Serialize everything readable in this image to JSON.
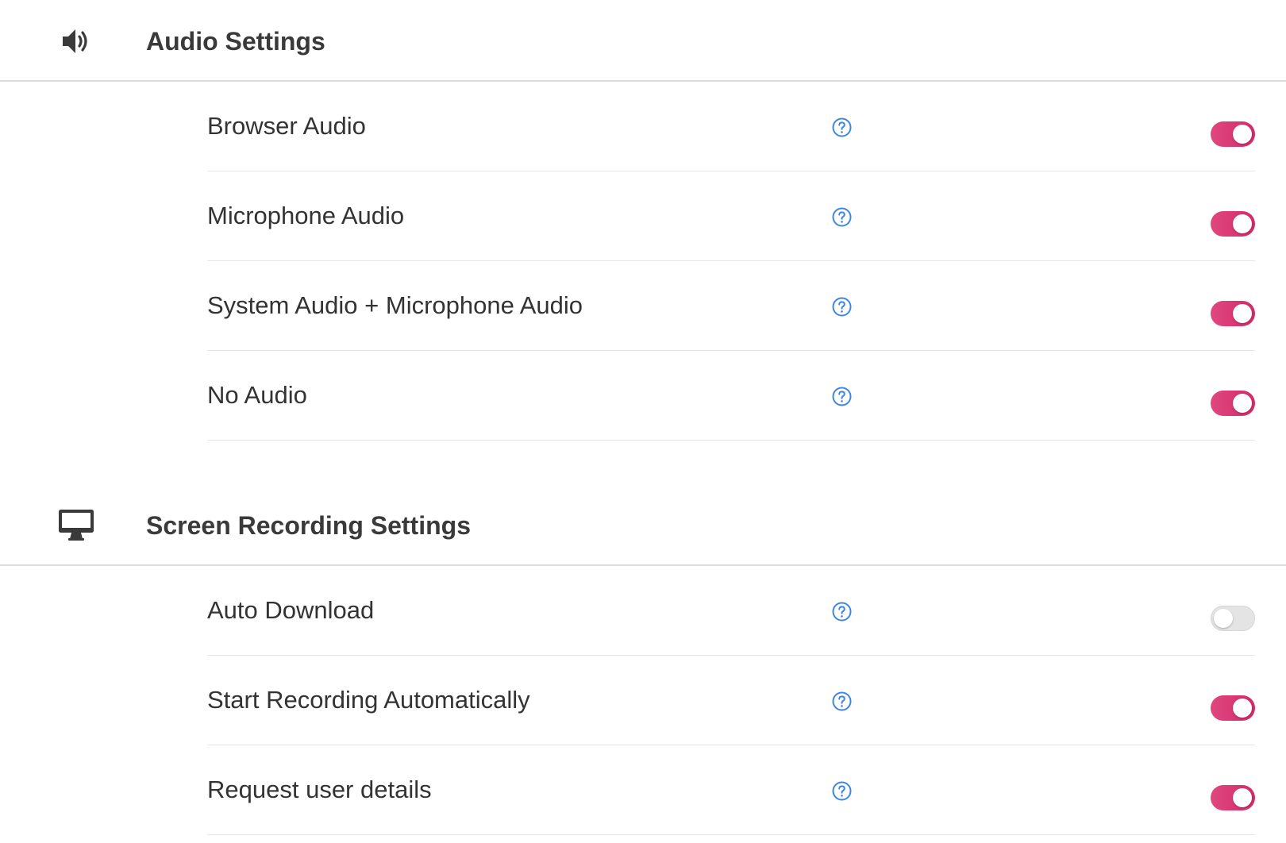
{
  "colors": {
    "accent": "#d92e71",
    "help_icon": "#3f86e0",
    "toggle_off": "#e4e4e4",
    "divider": "#dcdcdc"
  },
  "audio_section": {
    "icon": "speaker-icon",
    "title": "Audio Settings",
    "rows": [
      {
        "label": "Browser Audio",
        "enabled": true
      },
      {
        "label": "Microphone Audio",
        "enabled": true
      },
      {
        "label": "System Audio + Microphone Audio",
        "enabled": true
      },
      {
        "label": "No Audio",
        "enabled": true
      }
    ]
  },
  "screen_section": {
    "icon": "desktop-monitor-icon",
    "title": "Screen Recording Settings",
    "rows": [
      {
        "label": "Auto Download",
        "enabled": false
      },
      {
        "label": "Start Recording Automatically",
        "enabled": true
      },
      {
        "label": "Request user details",
        "enabled": true
      }
    ]
  }
}
